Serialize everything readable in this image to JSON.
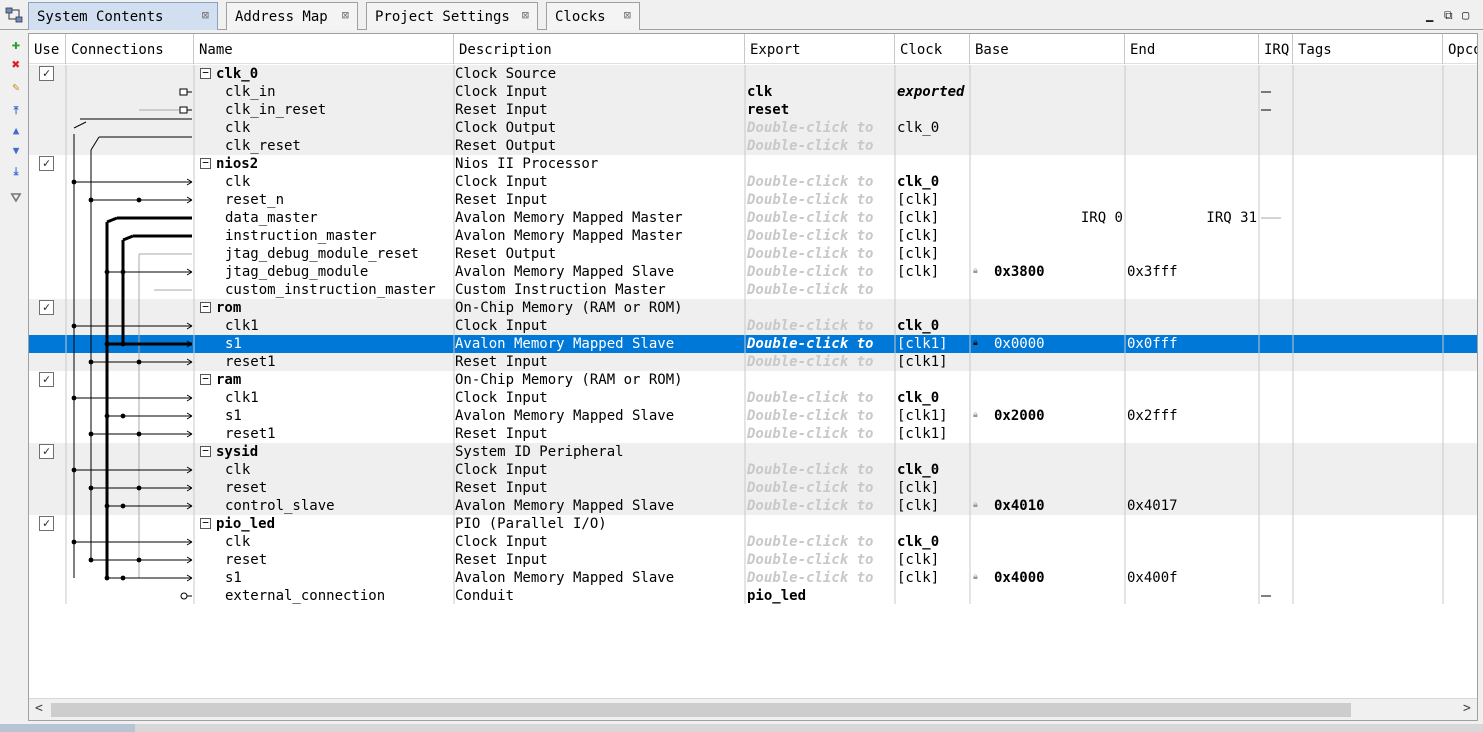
{
  "tabs": [
    {
      "label": "System Contents",
      "active": true
    },
    {
      "label": "Address Map",
      "active": false
    },
    {
      "label": "Project Settings",
      "active": false
    },
    {
      "label": "Clocks",
      "active": false
    }
  ],
  "tools": [
    "add-icon",
    "remove-icon",
    "edit-icon",
    "move-top-icon",
    "move-up-icon",
    "move-down-icon",
    "move-bottom-icon",
    "filter-icon"
  ],
  "columns": {
    "use": "Use",
    "connections": "Connections",
    "name": "Name",
    "description": "Description",
    "export": "Export",
    "clock": "Clock",
    "base": "Base",
    "end": "End",
    "irq": "IRQ",
    "tags": "Tags",
    "opcode": "Opco"
  },
  "export_hint": "Double-click to",
  "rows": [
    {
      "type": "module",
      "checked": true,
      "name": "clk_0",
      "description": "Clock Source",
      "export": "",
      "clock": "",
      "base": "",
      "end": "",
      "bg": "grey"
    },
    {
      "type": "iface",
      "name": "clk_in",
      "description": "Clock Input",
      "export": "clk",
      "export_bold": true,
      "clock": "exported",
      "clock_style": "exported",
      "bg": "grey"
    },
    {
      "type": "iface",
      "name": "clk_in_reset",
      "description": "Reset Input",
      "export": "reset",
      "export_bold": true,
      "clock": "",
      "bg": "grey"
    },
    {
      "type": "iface",
      "name": "clk",
      "description": "Clock Output",
      "export_hint": true,
      "clock": "clk_0",
      "bg": "grey"
    },
    {
      "type": "iface",
      "name": "clk_reset",
      "description": "Reset Output",
      "export_hint": true,
      "clock": "",
      "bg": "grey"
    },
    {
      "type": "module",
      "checked": true,
      "name": "nios2",
      "description": "Nios II Processor",
      "bg": "white"
    },
    {
      "type": "iface",
      "name": "clk",
      "description": "Clock Input",
      "export_hint": true,
      "clock": "clk_0",
      "clock_bold": true,
      "bg": "white"
    },
    {
      "type": "iface",
      "name": "reset_n",
      "description": "Reset Input",
      "export_hint": true,
      "clock": "[clk]",
      "bg": "white"
    },
    {
      "type": "iface",
      "name": "data_master",
      "description": "Avalon Memory Mapped Master",
      "export_hint": true,
      "clock": "[clk]",
      "base": "IRQ 0",
      "end": "IRQ 31",
      "bg": "white"
    },
    {
      "type": "iface",
      "name": "instruction_master",
      "description": "Avalon Memory Mapped Master",
      "export_hint": true,
      "clock": "[clk]",
      "bg": "white"
    },
    {
      "type": "iface",
      "name": "jtag_debug_module_reset",
      "description": "Reset Output",
      "export_hint": true,
      "clock": "[clk]",
      "bg": "white"
    },
    {
      "type": "iface",
      "name": "jtag_debug_module",
      "description": "Avalon Memory Mapped Slave",
      "export_hint": true,
      "clock": "[clk]",
      "base": "0x3800",
      "base_bold": true,
      "lock": true,
      "end": "0x3fff",
      "bg": "white"
    },
    {
      "type": "iface",
      "name": "custom_instruction_master",
      "description": "Custom Instruction Master",
      "export_hint": true,
      "clock": "",
      "bg": "white"
    },
    {
      "type": "module",
      "checked": true,
      "name": "rom",
      "description": "On-Chip Memory (RAM or ROM)",
      "bg": "grey"
    },
    {
      "type": "iface",
      "name": "clk1",
      "description": "Clock Input",
      "export_hint": true,
      "clock": "clk_0",
      "clock_bold": true,
      "bg": "grey"
    },
    {
      "type": "iface",
      "name": "s1",
      "description": "Avalon Memory Mapped Slave",
      "export_hint": true,
      "clock": "[clk1]",
      "base": "0x0000",
      "lock": true,
      "end": "0x0fff",
      "bg": "sel"
    },
    {
      "type": "iface",
      "name": "reset1",
      "description": "Reset Input",
      "export_hint": true,
      "clock": "[clk1]",
      "bg": "grey"
    },
    {
      "type": "module",
      "checked": true,
      "name": "ram",
      "description": "On-Chip Memory (RAM or ROM)",
      "bg": "white"
    },
    {
      "type": "iface",
      "name": "clk1",
      "description": "Clock Input",
      "export_hint": true,
      "clock": "clk_0",
      "clock_bold": true,
      "bg": "white"
    },
    {
      "type": "iface",
      "name": "s1",
      "description": "Avalon Memory Mapped Slave",
      "export_hint": true,
      "clock": "[clk1]",
      "base": "0x2000",
      "base_bold": true,
      "lock": true,
      "end": "0x2fff",
      "bg": "white"
    },
    {
      "type": "iface",
      "name": "reset1",
      "description": "Reset Input",
      "export_hint": true,
      "clock": "[clk1]",
      "bg": "white"
    },
    {
      "type": "module",
      "checked": true,
      "name": "sysid",
      "description": "System ID Peripheral",
      "bg": "grey"
    },
    {
      "type": "iface",
      "name": "clk",
      "description": "Clock Input",
      "export_hint": true,
      "clock": "clk_0",
      "clock_bold": true,
      "bg": "grey"
    },
    {
      "type": "iface",
      "name": "reset",
      "description": "Reset Input",
      "export_hint": true,
      "clock": "[clk]",
      "bg": "grey"
    },
    {
      "type": "iface",
      "name": "control_slave",
      "description": "Avalon Memory Mapped Slave",
      "export_hint": true,
      "clock": "[clk]",
      "base": "0x4010",
      "base_bold": true,
      "lock": true,
      "end": "0x4017",
      "bg": "grey"
    },
    {
      "type": "module",
      "checked": true,
      "name": "pio_led",
      "description": "PIO (Parallel I/O)",
      "bg": "white"
    },
    {
      "type": "iface",
      "name": "clk",
      "description": "Clock Input",
      "export_hint": true,
      "clock": "clk_0",
      "clock_bold": true,
      "bg": "white"
    },
    {
      "type": "iface",
      "name": "reset",
      "description": "Reset Input",
      "export_hint": true,
      "clock": "[clk]",
      "bg": "white"
    },
    {
      "type": "iface",
      "name": "s1",
      "description": "Avalon Memory Mapped Slave",
      "export_hint": true,
      "clock": "[clk]",
      "base": "0x4000",
      "base_bold": true,
      "lock": true,
      "end": "0x400f",
      "bg": "white"
    },
    {
      "type": "iface",
      "name": "external_connection",
      "description": "Conduit",
      "export": "pio_led",
      "export_bold": true,
      "clock": "",
      "bg": "white"
    }
  ],
  "colors": {
    "selection": "#0078d7",
    "grey_row": "#efefef",
    "wire": "#000000"
  }
}
